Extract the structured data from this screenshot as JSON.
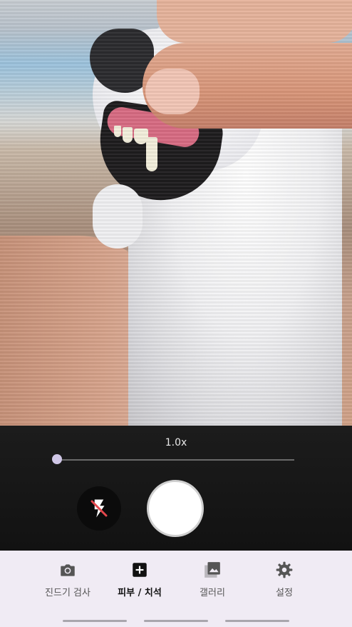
{
  "camera": {
    "zoom_label": "1.0x",
    "zoom_level": 0.0,
    "flash_icon": "flash-off-icon",
    "shutter_icon": "shutter-button"
  },
  "bottom_nav": {
    "items": [
      {
        "label": "진드기 검사",
        "icon": "camera-icon",
        "active": false
      },
      {
        "label": "피부 / 치석",
        "icon": "medical-plus-icon",
        "active": true
      },
      {
        "label": "갤러리",
        "icon": "gallery-icon",
        "active": false
      },
      {
        "label": "설정",
        "icon": "gear-icon",
        "active": false
      }
    ]
  },
  "colors": {
    "nav_background": "#f0ebf4",
    "zoom_thumb": "#cfc6e6",
    "flash_slash": "#e5484d"
  }
}
